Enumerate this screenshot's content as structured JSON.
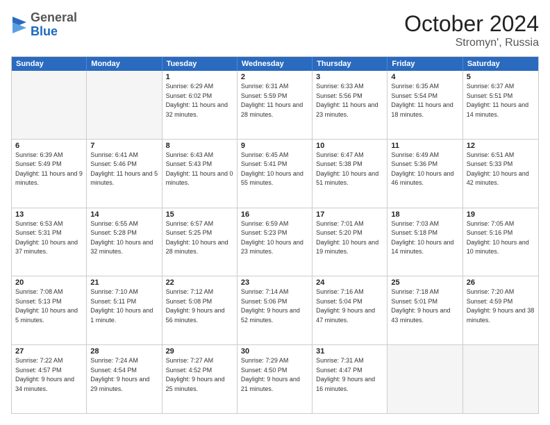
{
  "header": {
    "logo": {
      "general": "General",
      "blue": "Blue"
    },
    "month": "October 2024",
    "location": "Stromyn', Russia"
  },
  "weekdays": [
    "Sunday",
    "Monday",
    "Tuesday",
    "Wednesday",
    "Thursday",
    "Friday",
    "Saturday"
  ],
  "weeks": [
    [
      {
        "day": "",
        "sunrise": "",
        "sunset": "",
        "daylight": "",
        "empty": true
      },
      {
        "day": "",
        "sunrise": "",
        "sunset": "",
        "daylight": "",
        "empty": true
      },
      {
        "day": "1",
        "sunrise": "Sunrise: 6:29 AM",
        "sunset": "Sunset: 6:02 PM",
        "daylight": "Daylight: 11 hours and 32 minutes.",
        "empty": false
      },
      {
        "day": "2",
        "sunrise": "Sunrise: 6:31 AM",
        "sunset": "Sunset: 5:59 PM",
        "daylight": "Daylight: 11 hours and 28 minutes.",
        "empty": false
      },
      {
        "day": "3",
        "sunrise": "Sunrise: 6:33 AM",
        "sunset": "Sunset: 5:56 PM",
        "daylight": "Daylight: 11 hours and 23 minutes.",
        "empty": false
      },
      {
        "day": "4",
        "sunrise": "Sunrise: 6:35 AM",
        "sunset": "Sunset: 5:54 PM",
        "daylight": "Daylight: 11 hours and 18 minutes.",
        "empty": false
      },
      {
        "day": "5",
        "sunrise": "Sunrise: 6:37 AM",
        "sunset": "Sunset: 5:51 PM",
        "daylight": "Daylight: 11 hours and 14 minutes.",
        "empty": false
      }
    ],
    [
      {
        "day": "6",
        "sunrise": "Sunrise: 6:39 AM",
        "sunset": "Sunset: 5:49 PM",
        "daylight": "Daylight: 11 hours and 9 minutes.",
        "empty": false
      },
      {
        "day": "7",
        "sunrise": "Sunrise: 6:41 AM",
        "sunset": "Sunset: 5:46 PM",
        "daylight": "Daylight: 11 hours and 5 minutes.",
        "empty": false
      },
      {
        "day": "8",
        "sunrise": "Sunrise: 6:43 AM",
        "sunset": "Sunset: 5:43 PM",
        "daylight": "Daylight: 11 hours and 0 minutes.",
        "empty": false
      },
      {
        "day": "9",
        "sunrise": "Sunrise: 6:45 AM",
        "sunset": "Sunset: 5:41 PM",
        "daylight": "Daylight: 10 hours and 55 minutes.",
        "empty": false
      },
      {
        "day": "10",
        "sunrise": "Sunrise: 6:47 AM",
        "sunset": "Sunset: 5:38 PM",
        "daylight": "Daylight: 10 hours and 51 minutes.",
        "empty": false
      },
      {
        "day": "11",
        "sunrise": "Sunrise: 6:49 AM",
        "sunset": "Sunset: 5:36 PM",
        "daylight": "Daylight: 10 hours and 46 minutes.",
        "empty": false
      },
      {
        "day": "12",
        "sunrise": "Sunrise: 6:51 AM",
        "sunset": "Sunset: 5:33 PM",
        "daylight": "Daylight: 10 hours and 42 minutes.",
        "empty": false
      }
    ],
    [
      {
        "day": "13",
        "sunrise": "Sunrise: 6:53 AM",
        "sunset": "Sunset: 5:31 PM",
        "daylight": "Daylight: 10 hours and 37 minutes.",
        "empty": false
      },
      {
        "day": "14",
        "sunrise": "Sunrise: 6:55 AM",
        "sunset": "Sunset: 5:28 PM",
        "daylight": "Daylight: 10 hours and 32 minutes.",
        "empty": false
      },
      {
        "day": "15",
        "sunrise": "Sunrise: 6:57 AM",
        "sunset": "Sunset: 5:25 PM",
        "daylight": "Daylight: 10 hours and 28 minutes.",
        "empty": false
      },
      {
        "day": "16",
        "sunrise": "Sunrise: 6:59 AM",
        "sunset": "Sunset: 5:23 PM",
        "daylight": "Daylight: 10 hours and 23 minutes.",
        "empty": false
      },
      {
        "day": "17",
        "sunrise": "Sunrise: 7:01 AM",
        "sunset": "Sunset: 5:20 PM",
        "daylight": "Daylight: 10 hours and 19 minutes.",
        "empty": false
      },
      {
        "day": "18",
        "sunrise": "Sunrise: 7:03 AM",
        "sunset": "Sunset: 5:18 PM",
        "daylight": "Daylight: 10 hours and 14 minutes.",
        "empty": false
      },
      {
        "day": "19",
        "sunrise": "Sunrise: 7:05 AM",
        "sunset": "Sunset: 5:16 PM",
        "daylight": "Daylight: 10 hours and 10 minutes.",
        "empty": false
      }
    ],
    [
      {
        "day": "20",
        "sunrise": "Sunrise: 7:08 AM",
        "sunset": "Sunset: 5:13 PM",
        "daylight": "Daylight: 10 hours and 5 minutes.",
        "empty": false
      },
      {
        "day": "21",
        "sunrise": "Sunrise: 7:10 AM",
        "sunset": "Sunset: 5:11 PM",
        "daylight": "Daylight: 10 hours and 1 minute.",
        "empty": false
      },
      {
        "day": "22",
        "sunrise": "Sunrise: 7:12 AM",
        "sunset": "Sunset: 5:08 PM",
        "daylight": "Daylight: 9 hours and 56 minutes.",
        "empty": false
      },
      {
        "day": "23",
        "sunrise": "Sunrise: 7:14 AM",
        "sunset": "Sunset: 5:06 PM",
        "daylight": "Daylight: 9 hours and 52 minutes.",
        "empty": false
      },
      {
        "day": "24",
        "sunrise": "Sunrise: 7:16 AM",
        "sunset": "Sunset: 5:04 PM",
        "daylight": "Daylight: 9 hours and 47 minutes.",
        "empty": false
      },
      {
        "day": "25",
        "sunrise": "Sunrise: 7:18 AM",
        "sunset": "Sunset: 5:01 PM",
        "daylight": "Daylight: 9 hours and 43 minutes.",
        "empty": false
      },
      {
        "day": "26",
        "sunrise": "Sunrise: 7:20 AM",
        "sunset": "Sunset: 4:59 PM",
        "daylight": "Daylight: 9 hours and 38 minutes.",
        "empty": false
      }
    ],
    [
      {
        "day": "27",
        "sunrise": "Sunrise: 7:22 AM",
        "sunset": "Sunset: 4:57 PM",
        "daylight": "Daylight: 9 hours and 34 minutes.",
        "empty": false
      },
      {
        "day": "28",
        "sunrise": "Sunrise: 7:24 AM",
        "sunset": "Sunset: 4:54 PM",
        "daylight": "Daylight: 9 hours and 29 minutes.",
        "empty": false
      },
      {
        "day": "29",
        "sunrise": "Sunrise: 7:27 AM",
        "sunset": "Sunset: 4:52 PM",
        "daylight": "Daylight: 9 hours and 25 minutes.",
        "empty": false
      },
      {
        "day": "30",
        "sunrise": "Sunrise: 7:29 AM",
        "sunset": "Sunset: 4:50 PM",
        "daylight": "Daylight: 9 hours and 21 minutes.",
        "empty": false
      },
      {
        "day": "31",
        "sunrise": "Sunrise: 7:31 AM",
        "sunset": "Sunset: 4:47 PM",
        "daylight": "Daylight: 9 hours and 16 minutes.",
        "empty": false
      },
      {
        "day": "",
        "sunrise": "",
        "sunset": "",
        "daylight": "",
        "empty": true
      },
      {
        "day": "",
        "sunrise": "",
        "sunset": "",
        "daylight": "",
        "empty": true
      }
    ]
  ]
}
